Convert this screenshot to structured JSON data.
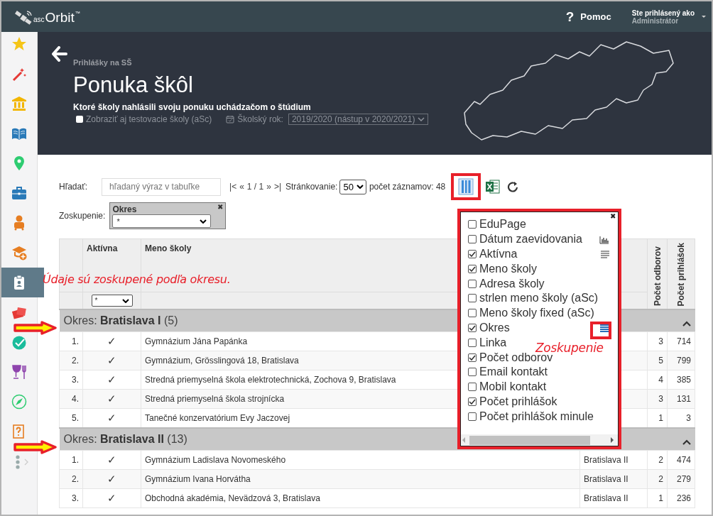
{
  "topbar": {
    "logo": {
      "prefix": "asc",
      "name": "Orbit",
      "mark": "™"
    },
    "help": "?",
    "help_label": "Pomoc",
    "user_caption": "Ste prihlásený ako",
    "user_name": "Administrátor"
  },
  "sidebar": {
    "items": [
      {
        "selected": false
      },
      {
        "selected": false
      },
      {
        "selected": false
      },
      {
        "selected": false
      },
      {
        "selected": false
      },
      {
        "selected": false
      },
      {
        "selected": false
      },
      {
        "selected": false
      },
      {
        "selected": true
      },
      {
        "selected": false
      },
      {
        "selected": false
      },
      {
        "selected": false
      },
      {
        "selected": false
      },
      {
        "selected": false
      }
    ]
  },
  "header": {
    "breadcrumb": "Prihlášky na SŠ",
    "title": "Ponuka škôl",
    "subtitle": "Ktoré školy nahlásili svoju ponuku uchádzačom o štúdium",
    "test_schools": {
      "label": "Zobraziť aj testovacie školy (aSc)",
      "checked": false
    },
    "school_year": {
      "label": "Školský rok:",
      "value": "2019/2020 (nástup v 2020/2021)"
    }
  },
  "toolbar": {
    "search_label": "Hľadať:",
    "search": {
      "placeholder": "hľadaný výraz v tabuľke"
    },
    "pager": {
      "first": "|<",
      "prev": "«",
      "page": "1 / 1",
      "next": "»",
      "last": ">|"
    },
    "paging_label": "Stránkovanie:",
    "paging_value": "50",
    "record_count": "počet záznamov: 48"
  },
  "grouping": {
    "label": "Zoskupenie:",
    "field": "Okres",
    "close": "✖",
    "filter": "*"
  },
  "table": {
    "columns": [
      {
        "kind": "index"
      },
      {
        "kind": "check",
        "label": "Aktívna",
        "filter": "*"
      },
      {
        "kind": "text",
        "label": "Meno školy"
      },
      {
        "kind": "text"
      },
      {
        "kind": "vertical",
        "label": "Počet odborov"
      },
      {
        "kind": "vertical",
        "label": "Počet prihlášok"
      }
    ],
    "groups": [
      {
        "title": "Okres: **Bratislava I** (5)",
        "expanded": true,
        "rows": [
          {
            "index": "1.",
            "active": "✓",
            "name": "Gymnázium Jána Papánka",
            "fields": "3",
            "applications": "714"
          },
          {
            "index": "2.",
            "active": "✓",
            "name": "Gymnázium, Grösslingová 18, Bratislava",
            "fields": "5",
            "applications": "799"
          },
          {
            "index": "3.",
            "active": "✓",
            "name": "Stredná priemyselná škola elektrotechnická, Zochova 9, Bratislava",
            "fields": "4",
            "applications": "385"
          },
          {
            "index": "4.",
            "active": "✓",
            "name": "Stredná priemyselná škola strojnícka",
            "fields": "3",
            "applications": "131"
          },
          {
            "index": "5.",
            "active": "✓",
            "name": "Tanečné konzervatórium Evy Jaczovej",
            "fields": "1",
            "applications": "3"
          }
        ]
      },
      {
        "title": "Okres: **Bratislava II** (13)",
        "expanded": true,
        "rows": [
          {
            "index": "1.",
            "active": "✓",
            "name": "Gymnázium Ladislava Novomeského",
            "okres": "Bratislava II",
            "fields": "2",
            "applications": "474"
          },
          {
            "index": "2.",
            "active": "✓",
            "name": "Gymnázium Ivana Horvátha",
            "okres": "Bratislava II",
            "fields": "2",
            "applications": "279"
          },
          {
            "index": "3.",
            "active": "✓",
            "name": "Obchodná akadémia, Nevädzová 3, Bratislava",
            "okres": "Bratislava II",
            "fields": "1",
            "applications": "236"
          }
        ]
      }
    ]
  },
  "column_chooser": {
    "close": "✖",
    "items": [
      {
        "label": "EduPage",
        "checked": false
      },
      {
        "label": "Dátum zaevidovania",
        "checked": false
      },
      {
        "label": "Aktívna",
        "checked": true
      },
      {
        "label": "Meno školy",
        "checked": true
      },
      {
        "label": "Adresa školy",
        "checked": false
      },
      {
        "label": "strlen meno školy (aSc)",
        "checked": false
      },
      {
        "label": "Meno školy fixed (aSc)",
        "checked": false
      },
      {
        "label": "Okres",
        "checked": true
      },
      {
        "label": "Linka",
        "checked": false
      },
      {
        "label": "Počet odborov",
        "checked": true
      },
      {
        "label": "Email kontakt",
        "checked": false
      },
      {
        "label": "Mobil kontakt",
        "checked": false
      },
      {
        "label": "Počet prihlášok",
        "checked": true
      },
      {
        "label": "Počet prihlášok minule",
        "checked": false
      }
    ]
  },
  "annotations": {
    "note": "Údaje sú zoskupené podľa okresu.",
    "grouping_note": "Zoskupenie"
  }
}
